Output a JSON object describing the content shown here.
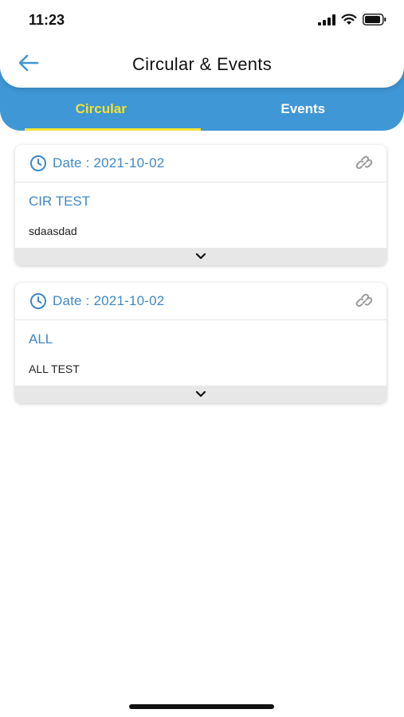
{
  "status_bar": {
    "time": "11:23"
  },
  "header": {
    "title": "Circular & Events",
    "back_icon": "arrow-left-icon"
  },
  "tabs": [
    {
      "label": "Circular",
      "active": true
    },
    {
      "label": "Events",
      "active": false
    }
  ],
  "colors": {
    "primary_blue": "#3f97d5",
    "accent_yellow": "#f3e233",
    "link_blue": "#3f88c5"
  },
  "circulars": [
    {
      "date": "Date : 2021-10-02",
      "title": "CIR TEST",
      "description": "sdaasdad"
    },
    {
      "date": "Date : 2021-10-02",
      "title": "ALL",
      "description": "ALL TEST"
    }
  ]
}
